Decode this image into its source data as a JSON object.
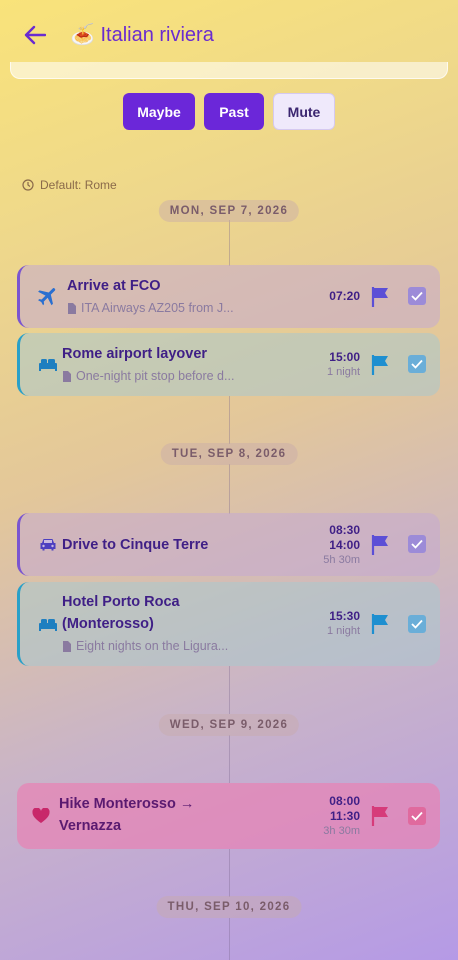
{
  "header": {
    "title": "🍝 Italian riviera"
  },
  "filters": [
    {
      "label": "Maybe",
      "active": true
    },
    {
      "label": "Past",
      "active": true
    },
    {
      "label": "Mute",
      "active": false
    }
  ],
  "default_tz": "Default: Rome",
  "days": [
    {
      "label": "MON, SEP 7, 2026"
    },
    {
      "label": "TUE, SEP 8, 2026"
    },
    {
      "label": "WED, SEP 9, 2026"
    },
    {
      "label": "THU, SEP 10, 2026"
    }
  ],
  "events": [
    {
      "title": "Arrive at FCO",
      "subtitle": "ITA Airways AZ205 from J...",
      "time1": "07:20",
      "icon": "airplane-icon",
      "style": "purple"
    },
    {
      "title": "Rome airport layover",
      "subtitle": "One-night pit stop before d...",
      "time1": "15:00",
      "duration": "1 night",
      "icon": "bed-icon",
      "style": "teal"
    },
    {
      "title": "Drive to Cinque Terre",
      "time1": "08:30",
      "time2": "14:00",
      "duration": "5h 30m",
      "icon": "car-icon",
      "style": "purple"
    },
    {
      "title_line1": "Hotel Porto Roca",
      "title_line2": "(Monterosso)",
      "subtitle": "Eight nights on the Ligura...",
      "time1": "15:30",
      "duration": "1 night",
      "icon": "bed-icon",
      "style": "teal"
    },
    {
      "title_line1": "Hike Monterosso →",
      "title_line2": "Vernazza",
      "time1": "08:00",
      "time2": "11:30",
      "duration": "3h 30m",
      "icon": "heart-icon",
      "style": "pink"
    }
  ],
  "colors": {
    "accent": "#6b27d9",
    "flag_purple": "#5b4fd6",
    "flag_teal": "#1e8fd0",
    "flag_pink": "#d63b7a"
  }
}
